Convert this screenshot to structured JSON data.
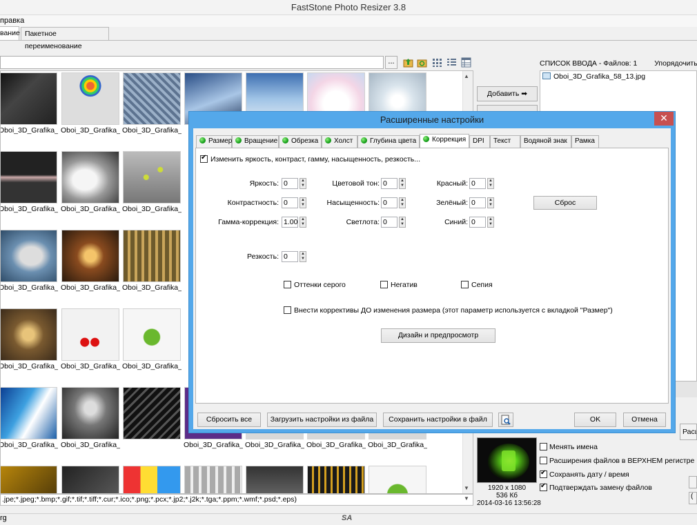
{
  "app": {
    "title": "FastStone Photo Resizer 3.8",
    "menu": "правка",
    "tabs": [
      "вание",
      "Пакетное переименование"
    ]
  },
  "toolbar": {
    "browse_label": "..."
  },
  "thumbnails": {
    "rows": [
      [
        "Oboi_3D_Grafika_...",
        "Oboi_3D_Grafika_...",
        "Oboi_3D_Grafika_...",
        "",
        "",
        "",
        ""
      ],
      [
        "Oboi_3D_Grafika_...",
        "Oboi_3D_Grafika_...",
        "Oboi_3D_Grafika_...",
        "",
        "",
        "",
        ""
      ],
      [
        "Oboi_3D_Grafika_...",
        "Oboi_3D_Grafika_...",
        "Oboi_3D_Grafika_...",
        "",
        "",
        "",
        ""
      ],
      [
        "Oboi_3D_Grafika_...",
        "Oboi_3D_Grafika_...",
        "Oboi_3D_Grafika_...",
        "",
        "",
        "",
        ""
      ],
      [
        "Oboi_3D_Grafika_...",
        "Oboi_3D_Grafika_...",
        "",
        "Oboi_3D_Grafika_...",
        "Oboi_3D_Grafika_...",
        "Oboi_3D_Grafika_...",
        "Oboi_3D_Grafika_..."
      ]
    ]
  },
  "filter": {
    "value": ".jpe;*.jpeg;*.bmp;*.gif;*.tif;*.tiff;*.cur;*.ico;*.png;*.pcx;*.jp2;*.j2k;*.tga;*.ppm;*.wmf;*.psd;*.eps)"
  },
  "status": {
    "left": "rg",
    "logo": "SA"
  },
  "right_panel": {
    "list_header": "СПИСОК ВВОДА  -  Файлов: 1",
    "sort_label": "Упорядочить фа",
    "add_button": "Добавить",
    "add_arrow": "➡",
    "list_items": [
      "Oboi_3D_Grafika_58_13.jpg"
    ],
    "edge_button": "Расш",
    "edge_button3": "(",
    "preview": {
      "resolution": "1920 x 1080",
      "size": "536 Кб",
      "date": "2014-03-16 13:56:28"
    },
    "options": [
      {
        "label": "Менять имена",
        "checked": false
      },
      {
        "label": "Расширения файлов в ВЕРХНЕМ регистре",
        "checked": false
      },
      {
        "label": "Сохранять дату / время",
        "checked": true
      },
      {
        "label": "Подтверждать замену файлов",
        "checked": true
      }
    ]
  },
  "dialog": {
    "title": "Расширенные  настройки",
    "close": "✕",
    "tabs": [
      {
        "label": "Размер",
        "dot": true
      },
      {
        "label": "Вращение",
        "dot": true
      },
      {
        "label": "Обрезка",
        "dot": true
      },
      {
        "label": "Холст",
        "dot": true
      },
      {
        "label": "Глубина цвета",
        "dot": true
      },
      {
        "label": "Коррекция",
        "dot": true,
        "active": true
      },
      {
        "label": "DPI",
        "dot": false
      },
      {
        "label": "Текст",
        "dot": false
      },
      {
        "label": "Водяной знак",
        "dot": false
      },
      {
        "label": "Рамка",
        "dot": false
      }
    ],
    "enable_check": "Изменить яркость, контраст, гамму, насыщенность, резкость...",
    "fields": {
      "brightness": {
        "label": "Яркость:",
        "value": "0"
      },
      "contrast": {
        "label": "Контрастность:",
        "value": "0"
      },
      "gamma": {
        "label": "Гамма-коррекция:",
        "value": "1.00"
      },
      "hue": {
        "label": "Цветовой тон:",
        "value": "0"
      },
      "saturation": {
        "label": "Насыщенность:",
        "value": "0"
      },
      "lightness": {
        "label": "Светлота:",
        "value": "0"
      },
      "red": {
        "label": "Красный:",
        "value": "0"
      },
      "green": {
        "label": "Зелёный:",
        "value": "0"
      },
      "blue": {
        "label": "Синий:",
        "value": "0"
      },
      "sharpness": {
        "label": "Резкость:",
        "value": "0"
      }
    },
    "reset_button": "Сброс",
    "grayscale": "Оттенки серого",
    "negative": "Негатив",
    "sepia": "Сепия",
    "before_resize": "Внести коррективы ДО изменения размера (этот параметр используется с вкладкой \"Размер\")",
    "preview_button": "Дизайн и предпросмотр",
    "footer": {
      "reset_all": "Сбросить все",
      "load": "Загрузить настройки из файла",
      "save": "Сохранить настройки в файл",
      "ok": "OK",
      "cancel": "Отмена"
    }
  }
}
